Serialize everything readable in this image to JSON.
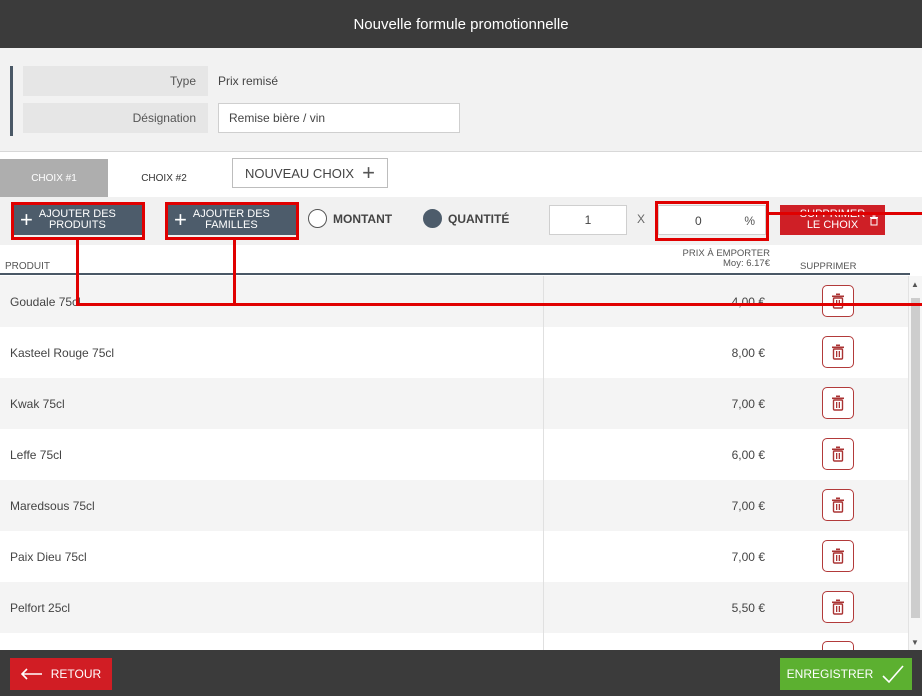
{
  "window": {
    "title": "Nouvelle formule promotionnelle"
  },
  "form": {
    "type_label": "Type",
    "type_value": "Prix remisé",
    "designation_label": "Désignation",
    "designation_value": "Remise bière / vin"
  },
  "tabs": [
    {
      "label": "CHOIX #1",
      "active": true
    },
    {
      "label": "CHOIX #2",
      "active": false
    }
  ],
  "new_choice_label": "NOUVEAU CHOIX",
  "toolbar": {
    "add_products_line1": "AJOUTER DES",
    "add_products_line2": "PRODUITS",
    "add_families_line1": "AJOUTER DES",
    "add_families_line2": "FAMILLES",
    "radio_amount_label": "MONTANT",
    "radio_quantity_label": "QUANTITÉ",
    "selected_radio": "QUANTITÉ",
    "quantity_value": "1",
    "multiply_label": "X",
    "percent_value": "0",
    "percent_unit": "%",
    "delete_choice_line1": "SUPPRIMER",
    "delete_choice_line2": "LE CHOIX"
  },
  "table": {
    "col_product": "PRODUIT",
    "col_price_line1": "PRIX À EMPORTER",
    "col_price_line2": "Moy: 6.17€",
    "col_delete": "SUPPRIMER",
    "rows": [
      {
        "name": "Goudale 75cl",
        "price": "4,00 €"
      },
      {
        "name": "Kasteel Rouge 75cl",
        "price": "8,00 €"
      },
      {
        "name": "Kwak 75cl",
        "price": "7,00 €"
      },
      {
        "name": "Leffe 75cl",
        "price": "6,00 €"
      },
      {
        "name": "Maredsous 75cl",
        "price": "7,00 €"
      },
      {
        "name": "Paix Dieu 75cl",
        "price": "7,00 €"
      },
      {
        "name": "Pelfort 25cl",
        "price": "5,50 €"
      }
    ]
  },
  "footer": {
    "back_label": "RETOUR",
    "save_label": "ENREGISTRER"
  },
  "colors": {
    "header_bg": "#3b3b3b",
    "button_dark": "#4d5c6b",
    "danger": "#cf1f26",
    "success": "#5cb030",
    "annotation": "#e00000"
  }
}
